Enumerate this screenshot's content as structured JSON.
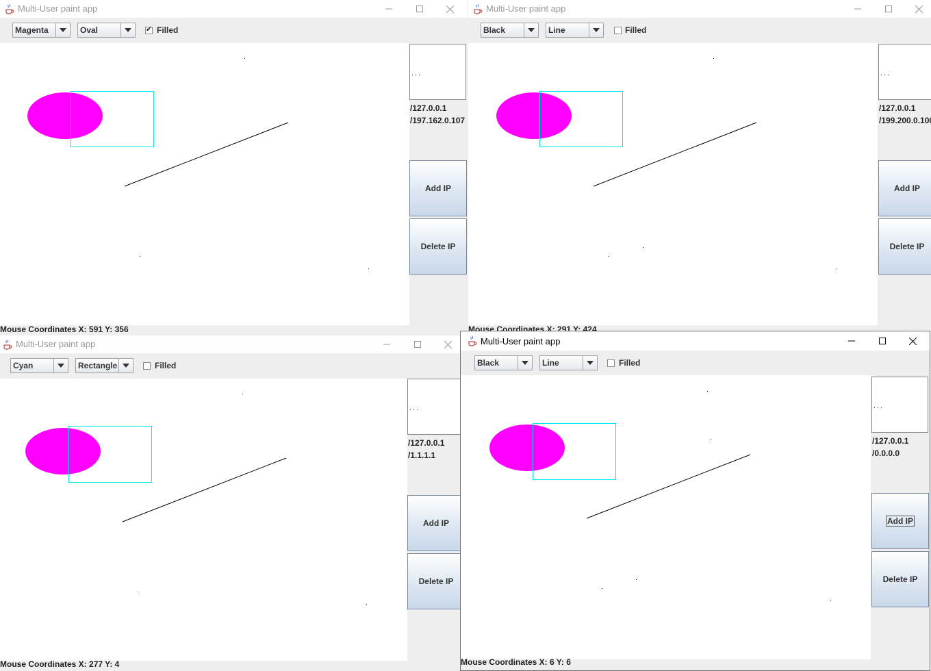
{
  "windows": [
    {
      "title": "Multi-User paint app",
      "color_value": "Magenta",
      "shape_value": "Oval",
      "filled_label": "Filled",
      "filled_checked": true,
      "ip_list_placeholder": "...",
      "ip_addresses": [
        "/127.0.0.1",
        "/197.162.0.107"
      ],
      "add_ip_label": "Add IP",
      "delete_ip_label": "Delete IP",
      "status": "Mouse Coordinates X: 591 Y: 356"
    },
    {
      "title": "Multi-User paint app",
      "color_value": "Black",
      "shape_value": "Line",
      "filled_label": "Filled",
      "filled_checked": false,
      "ip_list_placeholder": "...",
      "ip_addresses": [
        "/127.0.0.1",
        "/199.200.0.100"
      ],
      "add_ip_label": "Add IP",
      "delete_ip_label": "Delete IP",
      "status": "Mouse Coordinates X: 291 Y: 424"
    },
    {
      "title": "Multi-User paint app",
      "color_value": "Cyan",
      "shape_value": "Rectangle",
      "filled_label": "Filled",
      "filled_checked": false,
      "ip_list_placeholder": "...",
      "ip_addresses": [
        "/127.0.0.1",
        "/1.1.1.1"
      ],
      "add_ip_label": "Add IP",
      "delete_ip_label": "Delete IP",
      "status": "Mouse Coordinates X: 277 Y: 4"
    },
    {
      "title": "Multi-User paint app",
      "color_value": "Black",
      "shape_value": "Line",
      "filled_label": "Filled",
      "filled_checked": false,
      "ip_list_placeholder": "...",
      "ip_addresses": [
        "/127.0.0.1",
        "/0.0.0.0"
      ],
      "add_ip_label": "Add IP",
      "delete_ip_label": "Delete IP",
      "status": "Mouse Coordinates X: 6 Y: 6"
    }
  ],
  "colors": {
    "oval_fill": "#ff00ff",
    "rect_stroke": "#00e5e5",
    "line_stroke": "#000000"
  },
  "icons": {
    "app": "java-cup-icon",
    "minimize": "minimize-icon",
    "maximize": "maximize-icon",
    "close": "close-icon",
    "dropdown": "chevron-down-icon",
    "check": "checkmark-icon"
  }
}
